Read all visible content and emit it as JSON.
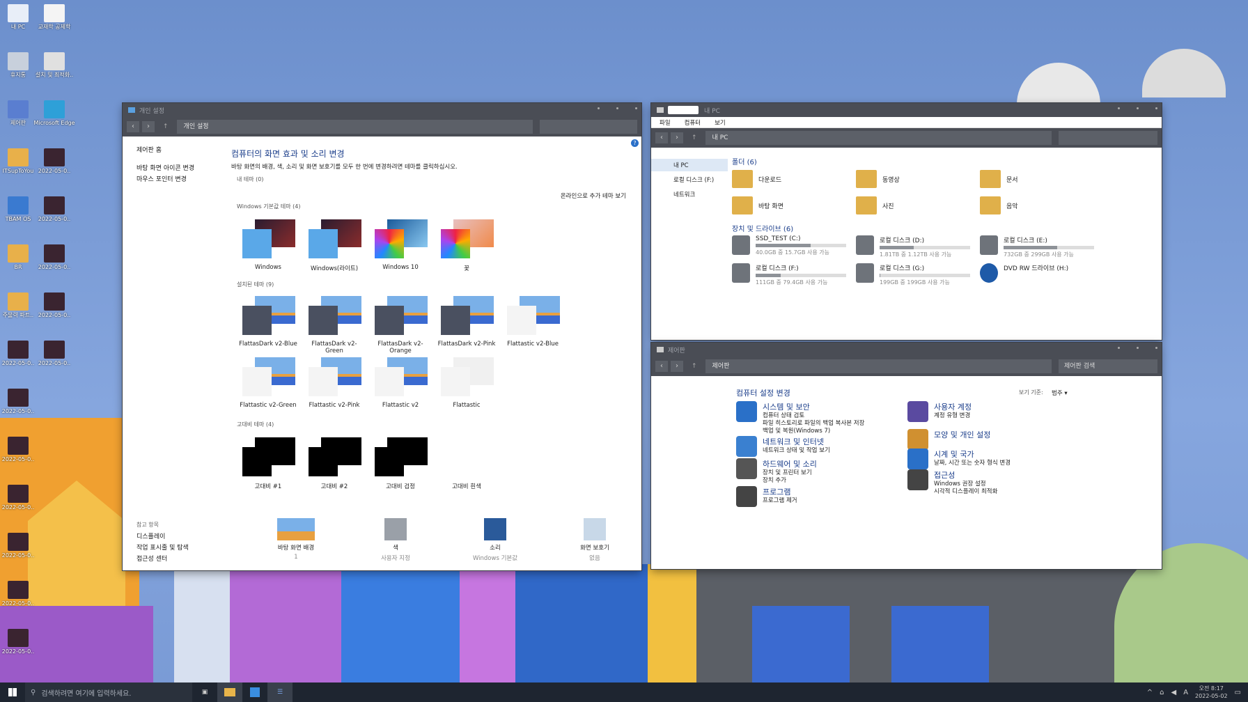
{
  "desktop_icons": [
    {
      "label": "내 PC",
      "icon": "monitor-icon"
    },
    {
      "label": "교재학 공제학",
      "icon": "document-icon"
    },
    {
      "label": "휴지통",
      "icon": "recycle-bin-icon"
    },
    {
      "label": "설치 및 최적화..",
      "icon": "gear-icon"
    },
    {
      "label": "제어판",
      "icon": "control-panel-icon"
    },
    {
      "label": "Microsoft Edge",
      "icon": "edge-icon"
    },
    {
      "label": "ITSupToYou",
      "icon": "folder-icon"
    },
    {
      "label": "2022-05-0..",
      "icon": "image-icon"
    },
    {
      "label": "TBAM OS",
      "icon": "globe-icon"
    },
    {
      "label": "2022-05-0..",
      "icon": "image-icon"
    },
    {
      "label": "BR",
      "icon": "folder-icon"
    },
    {
      "label": "2022-05-0..",
      "icon": "image-icon"
    },
    {
      "label": "주물력 파트..",
      "icon": "folder-icon"
    },
    {
      "label": "2022-05-0..",
      "icon": "image-icon"
    },
    {
      "label": "2022-05-0..",
      "icon": "image-icon"
    },
    {
      "label": "2022-05-0..",
      "icon": "image-icon"
    },
    {
      "label": "2022-05-0..",
      "icon": "image-icon"
    },
    {
      "label": "2022-05-0..",
      "icon": "image-icon"
    },
    {
      "label": "2022-05-0..",
      "icon": "image-icon"
    },
    {
      "label": "2022-05-0..",
      "icon": "image-icon"
    },
    {
      "label": "2022-05-0..",
      "icon": "image-icon"
    },
    {
      "label": "2022-05-0..",
      "icon": "image-icon"
    }
  ],
  "personalize": {
    "title": "개인 설정",
    "address": "개인 설정",
    "left_home": "제어판 홈",
    "left_links": [
      "바탕 화면 아이콘 변경",
      "마우스 포인터 변경"
    ],
    "heading": "컴퓨터의 화면 효과 및 소리 변경",
    "desc": "바탕 화면의 배경, 색, 소리 및 화면 보호기를 모두 한 번에 변경하려면 테마를 클릭하십시오.",
    "my_themes": "내 테마 (0)",
    "online_link": "온라인으로 추가 테마 보기",
    "default_group": "Windows 기본값 테마 (4)",
    "default_themes": [
      "Windows",
      "Windows(라이트)",
      "Windows 10",
      "꽃"
    ],
    "installed_group": "설치된 테마 (9)",
    "installed_themes": [
      "FlattasDark v2-Blue",
      "FlattasDark v2-Green",
      "FlattasDark v2-Orange",
      "FlattasDark v2-Pink",
      "Flattastic v2-Blue",
      "Flattastic v2-Green",
      "Flattastic v2-Pink",
      "Flattastic v2",
      "Flattastic"
    ],
    "contrast_group": "고대비 테마 (4)",
    "contrast_themes": [
      "고대비 #1",
      "고대비 #2",
      "고대비 검정",
      "고대비 흰색"
    ],
    "see_also": "참고 항목",
    "see_also_links": [
      "디스플레이",
      "작업 표시줄 및 탐색",
      "접근성 센터"
    ],
    "bottom": [
      {
        "label": "바탕 화면 배경",
        "sub": "1"
      },
      {
        "label": "색",
        "sub": "사용자 지정"
      },
      {
        "label": "소리",
        "sub": "Windows 기본값"
      },
      {
        "label": "화면 보호기",
        "sub": "없음"
      }
    ]
  },
  "mypc": {
    "title": "내 PC",
    "menu": [
      "파일",
      "컴퓨터",
      "보기"
    ],
    "address": "내 PC",
    "nav": [
      "내 PC",
      "로컬 디스크 (F:)",
      "네트워크"
    ],
    "folders_head": "폴더 (6)",
    "folders": [
      "다운로드",
      "동영상",
      "문서",
      "바탕 화면",
      "사진",
      "음악"
    ],
    "drives_head": "장치 및 드라이브 (6)",
    "drives": [
      {
        "name": "SSD_TEST (C:)",
        "info": "40.0GB 중 15.7GB 사용 가능",
        "used": 0.61
      },
      {
        "name": "로컬 디스크 (D:)",
        "info": "1.81TB 중 1.12TB 사용 가능",
        "used": 0.38
      },
      {
        "name": "로컬 디스크 (E:)",
        "info": "732GB 중 299GB 사용 가능",
        "used": 0.59
      },
      {
        "name": "로컬 디스크 (F:)",
        "info": "111GB 중 79.4GB 사용 가능",
        "used": 0.28
      },
      {
        "name": "로컬 디스크 (G:)",
        "info": "199GB 중 199GB 사용 가능",
        "used": 0.01
      },
      {
        "name": "DVD RW 드라이브 (H:)",
        "info": "",
        "used": 0
      }
    ]
  },
  "control": {
    "title": "제어판",
    "address": "제어판",
    "search": "제어판 검색",
    "heading": "컴퓨터 설정 변경",
    "view_by": "보기 기준:",
    "view_value": "범주 ▾",
    "items": [
      {
        "title": "시스템 및 보안",
        "subs": [
          "컴퓨터 상태 검토",
          "파일 히스토리로 파일의 백업 복사본 저장",
          "백업 및 복원(Windows 7)"
        ],
        "icon": "shield-icon"
      },
      {
        "title": "네트워크 및 인터넷",
        "subs": [
          "네트워크 상태 및 작업 보기"
        ],
        "icon": "network-icon"
      },
      {
        "title": "하드웨어 및 소리",
        "subs": [
          "장치 및 프린터 보기",
          "장치 추가"
        ],
        "icon": "printer-icon"
      },
      {
        "title": "프로그램",
        "subs": [
          "프로그램 제거"
        ],
        "icon": "tools-icon"
      },
      {
        "title": "사용자 계정",
        "subs": [
          "계정 유형 변경"
        ],
        "icon": "users-icon"
      },
      {
        "title": "모양 및 개인 설정",
        "subs": [],
        "icon": "brush-icon"
      },
      {
        "title": "시계 및 국가",
        "subs": [
          "날짜, 시간 또는 숫자 형식 변경"
        ],
        "icon": "clock-icon"
      },
      {
        "title": "접근성",
        "subs": [
          "Windows 권장 설정",
          "시각적 디스플레이 최적화"
        ],
        "icon": "accessibility-icon"
      }
    ]
  },
  "taskbar": {
    "search_placeholder": "검색하려면 여기에 입력하세요.",
    "ime": "A",
    "time": "오전 8:17",
    "date": "2022-05-02"
  }
}
